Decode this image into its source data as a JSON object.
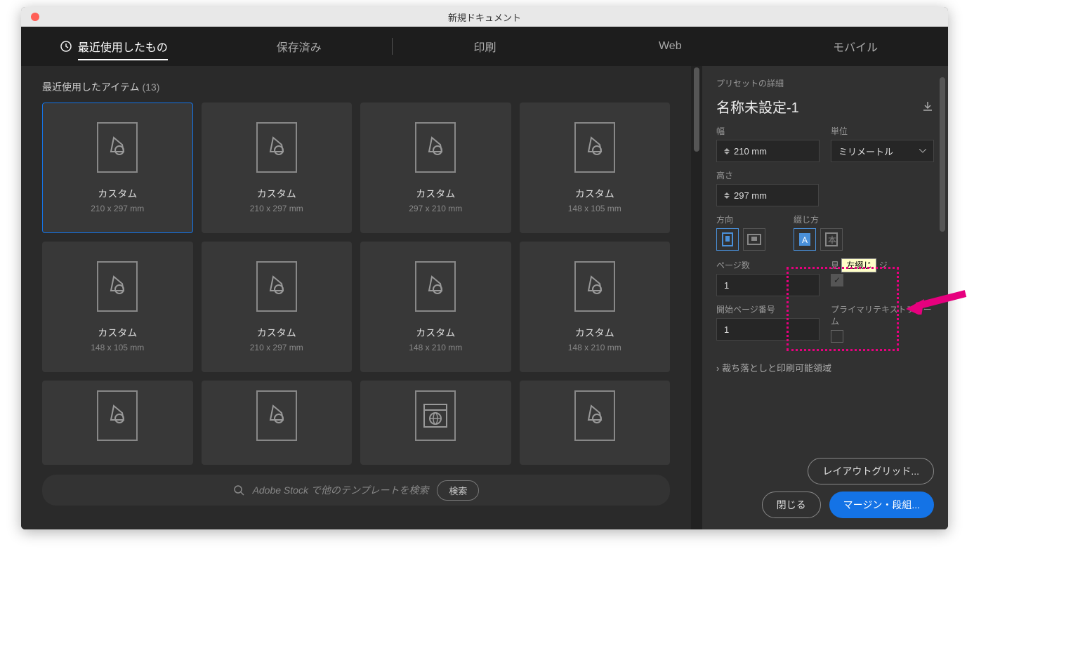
{
  "window_title": "新規ドキュメント",
  "tabs": {
    "recent": "最近使用したもの",
    "saved": "保存済み",
    "print": "印刷",
    "web": "Web",
    "mobile": "モバイル"
  },
  "recent_label": "最近使用したアイテム",
  "recent_count": "(13)",
  "cards": [
    {
      "name": "カスタム",
      "dim": "210 x 297 mm"
    },
    {
      "name": "カスタム",
      "dim": "210 x 297 mm"
    },
    {
      "name": "カスタム",
      "dim": "297 x 210 mm"
    },
    {
      "name": "カスタム",
      "dim": "148 x 105 mm"
    },
    {
      "name": "カスタム",
      "dim": "148 x 105 mm"
    },
    {
      "name": "カスタム",
      "dim": "210 x 297 mm"
    },
    {
      "name": "カスタム",
      "dim": "148 x 210 mm"
    },
    {
      "name": "カスタム",
      "dim": "148 x 210 mm"
    }
  ],
  "row3_card_name": "",
  "stock_placeholder": "Adobe Stock で他のテンプレートを検索",
  "stock_search": "検索",
  "preset_detail_label": "プリセットの詳細",
  "doc_name": "名称未設定-1",
  "width_label": "幅",
  "width_value": "210 mm",
  "unit_label": "単位",
  "unit_value": "ミリメートル",
  "height_label": "高さ",
  "height_value": "297 mm",
  "orientation_label": "方向",
  "binding_label": "綴じ方",
  "pages_label": "ページ数",
  "pages_value": "1",
  "facing_label": "見",
  "facing_label_rest": "ジ",
  "start_page_label": "開始ページ番号",
  "start_page_value": "1",
  "primary_tf_label": "プライマリテキストフレーム",
  "bleed_label": "裁ち落としと印刷可能領域",
  "btn_layout_grid": "レイアウトグリッド...",
  "btn_close": "閉じる",
  "btn_margin": "マージン・段組...",
  "tooltip_text": "左綴じ"
}
